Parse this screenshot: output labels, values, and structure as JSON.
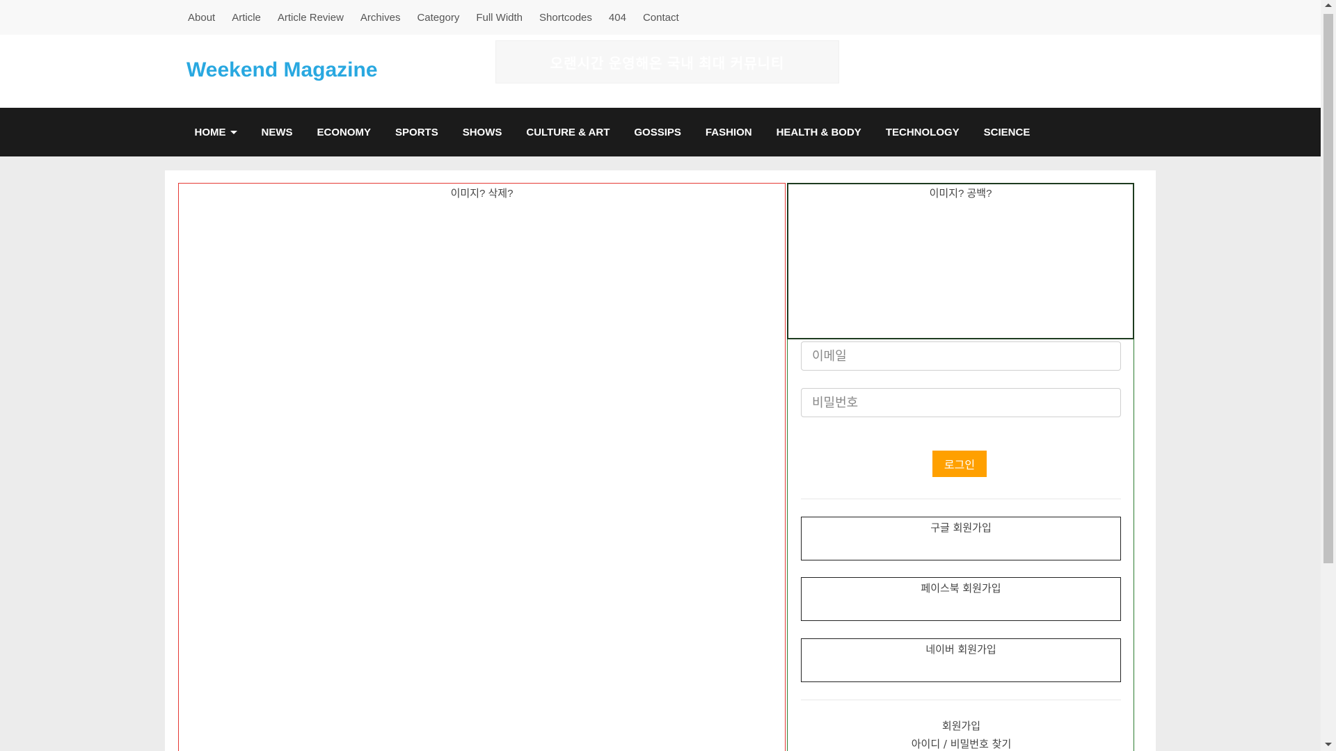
{
  "top_nav": {
    "items": [
      "About",
      "Article",
      "Article Review",
      "Archives",
      "Category",
      "Full Width",
      "Shortcodes",
      "404",
      "Contact"
    ]
  },
  "header": {
    "brand": "Weekend Magazine",
    "banner_text": "오랜시간 운영해온 국내 최대 커뮤니티"
  },
  "main_nav": {
    "items": [
      "HOME",
      "NEWS",
      "ECONOMY",
      "SPORTS",
      "SHOWS",
      "CULTURE & ART",
      "GOSSIPS",
      "FASHION",
      "HEALTH & BODY",
      "TECHNOLOGY",
      "SCIENCE"
    ]
  },
  "left_panel": {
    "caption": "이미지? 삭제?"
  },
  "right_panel": {
    "image_caption": "이미지? 공백?",
    "email_placeholder": "이메일",
    "password_placeholder": "비밀번호",
    "login_label": "로그인",
    "google_signup": "구글 회원가입",
    "facebook_signup": "페이스북 회원가입",
    "naver_signup": "네이버 회원가입",
    "signup_link": "회원가입",
    "find_link": "아이디 / 비밀번호 찾기"
  },
  "colors": {
    "brand": "#29a8e0",
    "nav_bg": "#1b1b1b",
    "login_button": "#ffa000",
    "left_border": "#e53935",
    "right_border": "#2e7d32"
  },
  "icons": {
    "dropdown": "caret-down-icon"
  }
}
